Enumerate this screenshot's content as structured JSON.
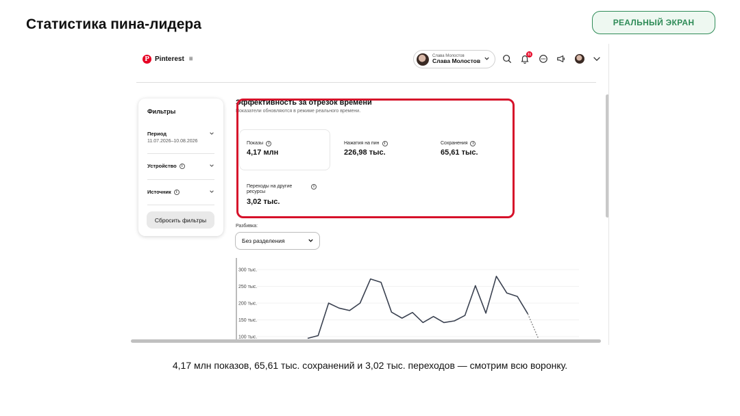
{
  "slide": {
    "title": "Статистика пина-лидера",
    "badge": "РЕАЛЬНЫЙ ЭКРАН",
    "caption": "4,17 млн показов, 65,61 тыс. сохранений и 3,02 тыс. переходов — смотрим всю воронку."
  },
  "header": {
    "logo_text": "Pinterest",
    "menu_icon": "≡",
    "account_label_small": "Слава Молостов",
    "account_name": "Слава Молостов",
    "notification_count": "31",
    "icons": [
      "search-icon",
      "bell-icon",
      "chat-icon",
      "megaphone-icon",
      "avatar",
      "chevron-down-icon"
    ]
  },
  "filters": {
    "title": "Фильтры",
    "period_label": "Период",
    "period_value": "11.07.2026–10.08.2026",
    "device_label": "Устройство",
    "source_label": "Источник",
    "reset_label": "Сбросить фильтры"
  },
  "performance": {
    "title": "Эффективность за отрезок времени",
    "subtitle": "Показатели обновляются в режиме реального времени.",
    "highlight_color": "#d6112a",
    "metrics": [
      {
        "label": "Показы",
        "value": "4,17 млн"
      },
      {
        "label": "Нажатия на пин",
        "value": "226,98 тыс."
      },
      {
        "label": "Сохранения",
        "value": "65,61 тыс."
      },
      {
        "label": "Переходы на другие ресурсы",
        "value": "3,02 тыс."
      }
    ]
  },
  "breakdown": {
    "label": "Разбивка:",
    "selected": "Без разделения"
  },
  "chart_data": {
    "type": "line",
    "ytick_labels": [
      "300 тыс.",
      "250 тыс.",
      "200 тыс.",
      "150 тыс.",
      "100 тыс."
    ],
    "ylim": [
      90000,
      320000
    ],
    "series": [
      {
        "values": [
          95000,
          103000,
          200000,
          185000,
          178000,
          200000,
          272000,
          262000,
          173000,
          155000,
          172000,
          142000,
          160000,
          142000,
          147000,
          163000,
          252000,
          170000,
          280000,
          230000,
          220000,
          168000,
          95000
        ]
      }
    ],
    "dashed_from_index": 21,
    "line_color": "#3a4150",
    "grid": true
  }
}
